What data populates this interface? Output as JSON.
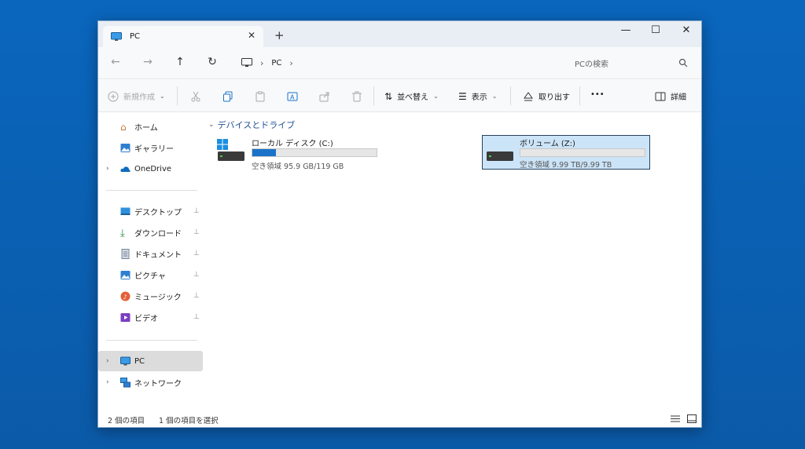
{
  "tab": {
    "title": "PC",
    "close": "✕",
    "new_tab": "+"
  },
  "window_controls": {
    "minimize": "—",
    "maximize": "☐",
    "close": "✕"
  },
  "nav": {
    "back": "←",
    "forward": "→",
    "up": "↑",
    "refresh": "↻"
  },
  "address": {
    "crumb": "PC",
    "sep": "›"
  },
  "search": {
    "placeholder": "PCの検索"
  },
  "commands": {
    "new": "新規作成",
    "sort": "並べ替え",
    "view": "表示",
    "eject": "取り出す",
    "more": "•••",
    "details": "詳細"
  },
  "sidebar": {
    "home": "ホーム",
    "gallery": "ギャラリー",
    "onedrive": "OneDrive",
    "desktop": "デスクトップ",
    "downloads": "ダウンロード",
    "documents": "ドキュメント",
    "pictures": "ピクチャ",
    "music": "ミュージック",
    "videos": "ビデオ",
    "pc": "PC",
    "network": "ネットワーク",
    "expand": "›",
    "pin": "📌"
  },
  "main": {
    "group_title": "デバイスとドライブ",
    "drives": [
      {
        "name": "ローカル ディスク (C:)",
        "free": "空き領域 95.9 GB/119 GB",
        "used_fraction": 0.19
      },
      {
        "name": "ボリューム (Z:)",
        "free": "空き領域 9.99 TB/9.99 TB",
        "used_fraction": 0.0
      }
    ]
  },
  "status": {
    "items": "2 個の項目",
    "selected": "1 個の項目を選択"
  },
  "colors": {
    "accent": "#1a73c9",
    "selection": "#cce4f7",
    "background": "#0b5fb0"
  }
}
